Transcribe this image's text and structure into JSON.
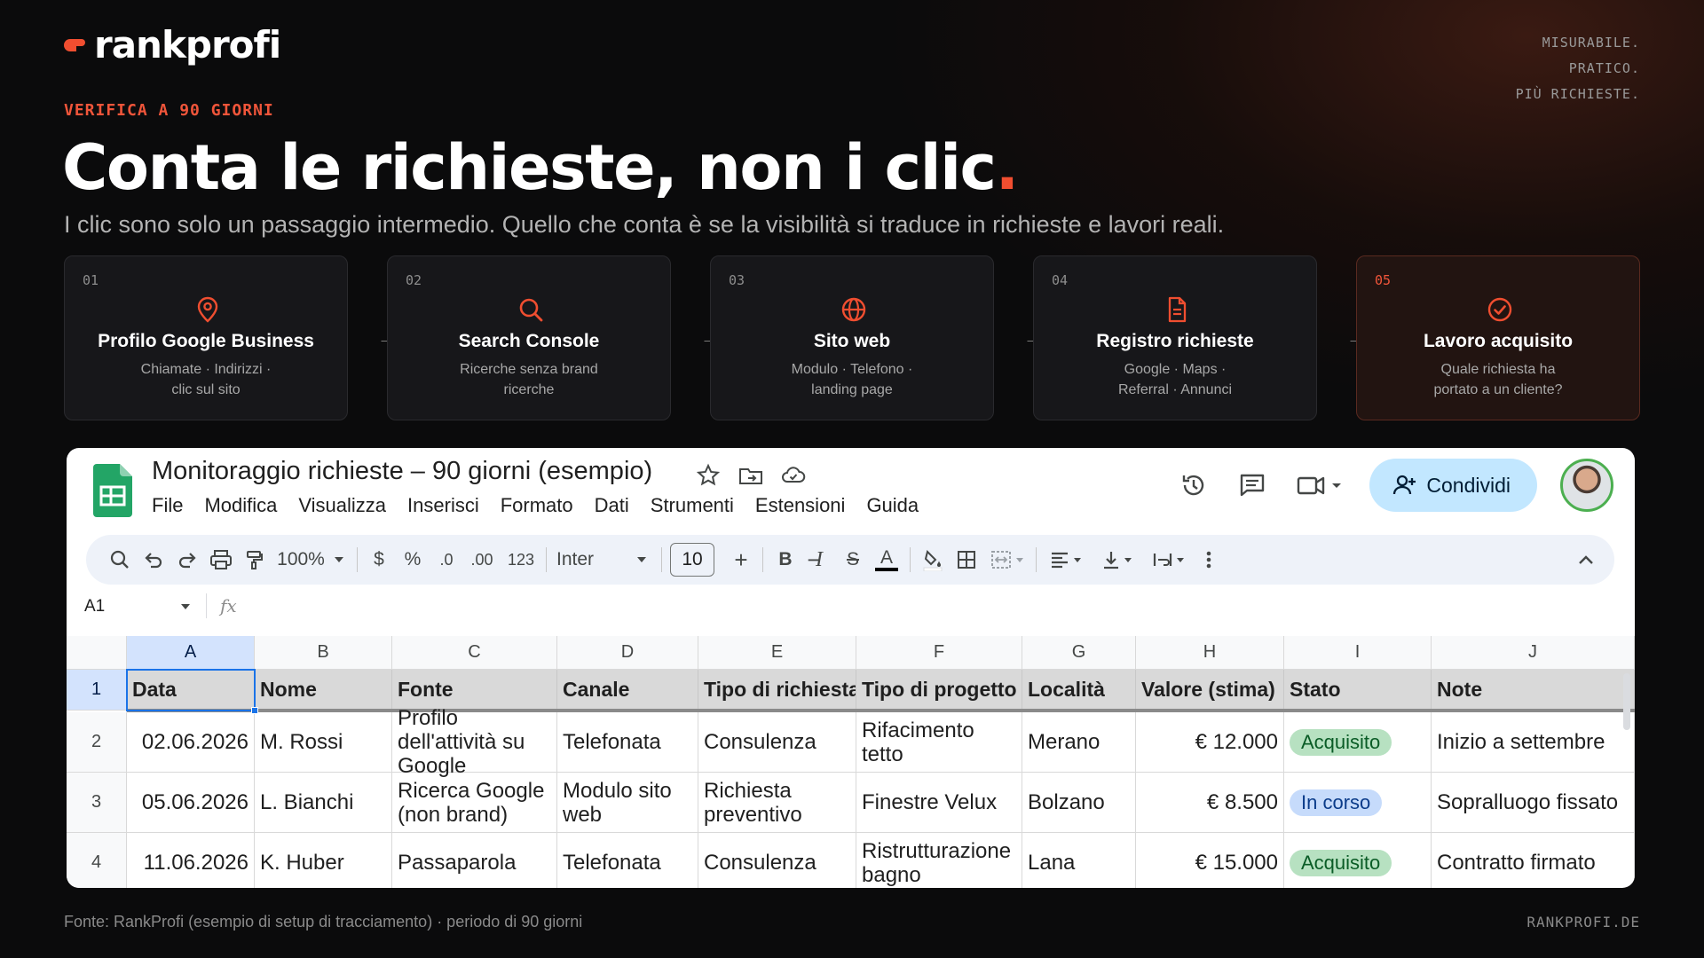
{
  "brand": {
    "logo_text": "rankprofi",
    "accent_color": "#f04e30",
    "tagline": [
      "MISURABILE.",
      "PRATICO.",
      "PIÙ RICHIESTE."
    ]
  },
  "eyebrow": "VERIFICA A 90 GIORNI",
  "headline": {
    "text": "Conta le richieste, non i clic",
    "dot": "."
  },
  "subline": "I clic sono solo un passaggio intermedio. Quello che conta è se la visibilità si traduce in richieste e lavori reali.",
  "steps": [
    {
      "num": "01",
      "icon": "map-pin-icon",
      "title": "Profilo Google Business",
      "desc": [
        "Chiamate · Indirizzi ·",
        "clic sul sito"
      ]
    },
    {
      "num": "02",
      "icon": "search-icon",
      "title": "Search Console",
      "desc": [
        "Ricerche senza brand",
        "ricerche"
      ]
    },
    {
      "num": "03",
      "icon": "globe-icon",
      "title": "Sito web",
      "desc": [
        "Modulo · Telefono ·",
        "landing page"
      ]
    },
    {
      "num": "04",
      "icon": "document-icon",
      "title": "Registro richieste",
      "desc": [
        "Google · Maps ·",
        "Referral · Annunci"
      ]
    },
    {
      "num": "05",
      "icon": "check-circle-icon",
      "title": "Lavoro acquisito",
      "desc": [
        "Quale richiesta ha",
        "portato a un cliente?"
      ]
    }
  ],
  "step_arrow": "→",
  "sheet": {
    "title": "Monitoraggio richieste – 90 giorni (esempio)",
    "menu": [
      "File",
      "Modifica",
      "Visualizza",
      "Inserisci",
      "Formato",
      "Dati",
      "Strumenti",
      "Estensioni",
      "Guida"
    ],
    "share_label": "Condividi",
    "toolbar": {
      "zoom": "100%",
      "currency": "$",
      "percent": "%",
      "dec_less": ".0",
      "dec_more": ".00",
      "number_format": "123",
      "font": "Inter",
      "font_size": "10",
      "minus": "−",
      "plus": "+",
      "bold": "B",
      "italic": "I",
      "strike": "S",
      "text_color": "A"
    },
    "namebox": "A1",
    "fx": "fx",
    "columns": [
      "A",
      "B",
      "C",
      "D",
      "E",
      "F",
      "G",
      "H",
      "I",
      "J"
    ],
    "row_numbers": [
      "1",
      "2",
      "3",
      "4"
    ],
    "headers": [
      "Data",
      "Nome",
      "Fonte",
      "Canale",
      "Tipo di richiesta",
      "Tipo di progetto",
      "Località",
      "Valore (stima)",
      "Stato",
      "Note"
    ],
    "rows": [
      [
        "02.06.2026",
        "M. Rossi",
        "Profilo dell'attività su Google",
        "Telefonata",
        "Consulenza",
        "Rifacimento tetto",
        "Merano",
        "€ 12.000",
        "Acquisito",
        "Inizio a settembre"
      ],
      [
        "05.06.2026",
        "L. Bianchi",
        "Ricerca Google (non brand)",
        "Modulo sito web",
        "Richiesta preventivo",
        "Finestre Velux",
        "Bolzano",
        "€ 8.500",
        "In corso",
        "Sopralluogo fissato"
      ],
      [
        "11.06.2026",
        "K. Huber",
        "Passaparola",
        "Telefonata",
        "Consulenza",
        "Ristrutturazione bagno",
        "Lana",
        "€ 15.000",
        "Acquisito",
        "Contratto firmato"
      ]
    ],
    "status_colors": {
      "Acquisito": "#b7e1c1",
      "In corso": "#c6dbfb"
    }
  },
  "footer": {
    "source": "Fonte: RankProfi (esempio di setup di tracciamento) · periodo di 90 giorni",
    "site": "RANKPROFI.DE"
  }
}
